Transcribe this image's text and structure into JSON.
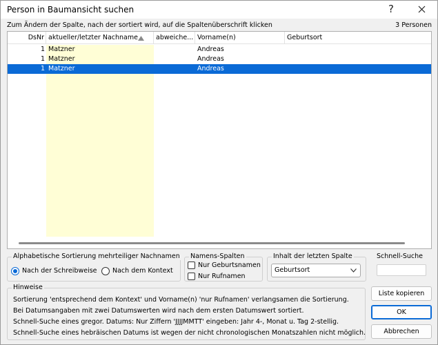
{
  "window": {
    "title": "Person in Baumansicht suchen",
    "help_glyph": "?",
    "close_glyph": "✕"
  },
  "hint_top": "Zum Ändern der Spalte, nach der sortiert wird, auf die Spaltenüberschrift klicken",
  "person_count": "3 Personen",
  "table": {
    "columns": [
      "DsNr",
      "aktueller/letzter Nachname",
      "abweiche...",
      "Vorname(n)",
      "Geburtsort"
    ],
    "rows": [
      {
        "dsnr": "1",
        "nachname": "Matzner",
        "abweichend": "",
        "vorname": "Andreas",
        "geburtsort": "",
        "selected": false
      },
      {
        "dsnr": "1",
        "nachname": "Matzner",
        "abweichend": "",
        "vorname": "Andreas",
        "geburtsort": "",
        "selected": false
      },
      {
        "dsnr": "1",
        "nachname": "Matzner",
        "abweichend": "",
        "vorname": "Andreas",
        "geburtsort": "",
        "selected": true
      }
    ]
  },
  "alpha_sort": {
    "label": "Alphabetische Sortierung mehrteiliger Nachnamen",
    "options": [
      "Nach der Schreibweise",
      "Nach dem Kontext"
    ],
    "selected": "Nach der Schreibweise"
  },
  "namens_spalten": {
    "label": "Namens-Spalten",
    "options": [
      {
        "label": "Nur Geburtsnamen",
        "checked": false
      },
      {
        "label": "Nur Rufnamen",
        "checked": false
      }
    ]
  },
  "inhalt": {
    "label": "Inhalt der letzten Spalte",
    "value": "Geburtsort"
  },
  "schnell_suche": {
    "label": "Schnell-Suche",
    "value": ""
  },
  "hinweise": {
    "label": "Hinweise",
    "lines": [
      "Sortierung 'entsprechend dem Kontext' und Vorname(n) 'nur Rufnamen' verlangsamen die Sortierung.",
      "Bei Datumsangaben mit zwei Datumswerten wird nach dem ersten Datumswert sortiert.",
      "Schnell-Suche eines gregor. Datums: Nur Ziffern 'JJJJMMTT' eingeben: Jahr 4-, Monat u. Tag 2-stellig.",
      "Schnell-Suche eines hebräischen Datums ist wegen der nicht chronologischen Monatszahlen nicht möglich."
    ]
  },
  "buttons": {
    "copy": "Liste kopieren",
    "ok": "OK",
    "cancel": "Abbrechen"
  },
  "colors": {
    "selection": "#0a6ad6",
    "sorted_column_bg": "#fffed6"
  }
}
